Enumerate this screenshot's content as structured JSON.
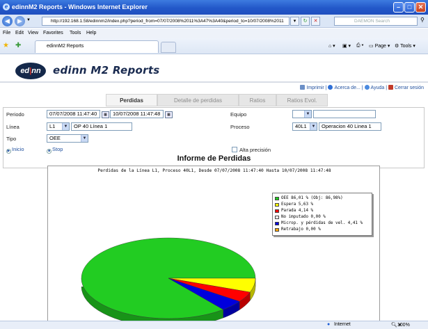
{
  "window": {
    "title": "edinnM2 Reports - Windows Internet Explorer",
    "url": "http://192.168.1.58/edinnm2/index.php?period_from=07/07/2008%2011%3A47%3A40&period_to=10/07/2008%2011",
    "search_placeholder": "DAEMON Search",
    "menu": [
      "File",
      "Edit",
      "View",
      "Favorites",
      "Tools",
      "Help"
    ],
    "tab_label": "edinnM2 Reports",
    "toolbar": {
      "page": "Page",
      "tools": "Tools"
    },
    "status": {
      "zone": "Internet",
      "zoom": "100%"
    }
  },
  "app": {
    "logo_left": "ed",
    "logo_right": "nn",
    "title": "edinn M2 Reports",
    "links": {
      "print": "Imprimir",
      "about": "Acerca de...",
      "help": "Ayuda",
      "logout": "Cerrar sesión"
    },
    "tabs": [
      "Perdidas",
      "Detalle de perdidas",
      "Ratios",
      "Ratios Evol."
    ],
    "active_tab": "Perdidas"
  },
  "form": {
    "period_label": "Periodo",
    "period_from": "07/07/2008 11:47:40",
    "period_to": "10/07/2008 11:47:48",
    "line_label": "Línea",
    "line_code": "L1",
    "line_name": "OP 40 Línea 1",
    "type_label": "Tipo",
    "type_value": "OEE",
    "equipment_label": "Equipo",
    "equipment_code": "",
    "equipment_name": "",
    "process_label": "Proceso",
    "process_code": "40L1",
    "process_name": "Operacion 40 Linea 1",
    "high_precision_label": "Alta precisión",
    "start_button": "Inicio",
    "stop_button": "Stop"
  },
  "report": {
    "title": "Informe de Perdidas"
  },
  "chart_data": {
    "type": "pie",
    "title": "Perdidas de la Línea L1, Proceso 40L1, Desde 07/07/2008 11:47:40 Hasta 10/07/2008 11:47:48",
    "slices": [
      {
        "label": "OEE 86,01 % (Obj: 86,98%)",
        "value": 86.01,
        "color": "#22cc22"
      },
      {
        "label": "Espera 5,63 %",
        "value": 5.63,
        "color": "#ffff00"
      },
      {
        "label": "Parada 4,14 %",
        "value": 4.14,
        "color": "#ff0000"
      },
      {
        "label": "No imputado 0,00 %",
        "value": 0.0,
        "color": "#ffffff"
      },
      {
        "label": "Microp. y pérdidas de vel. 4,41 %",
        "value": 4.41,
        "color": "#0000dd"
      },
      {
        "label": "Retrabajo 0,00 %",
        "value": 0.0,
        "color": "#ffa500"
      }
    ],
    "legend_position": "top-right",
    "style": "3d"
  }
}
